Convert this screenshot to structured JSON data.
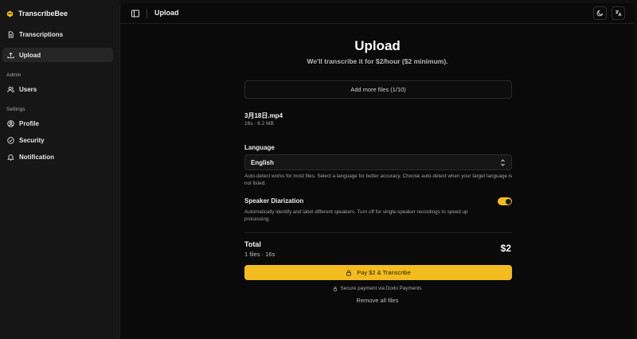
{
  "app": {
    "name": "TranscribeBee",
    "accent_color": "#f2bc1f"
  },
  "sidebar": {
    "items": [
      {
        "label": "Transcriptions",
        "icon": "file-text-icon"
      },
      {
        "label": "Upload",
        "icon": "upload-icon",
        "active": true
      }
    ],
    "admin_label": "Admin",
    "admin_items": [
      {
        "label": "Users",
        "icon": "users-icon"
      }
    ],
    "settings_label": "Settings",
    "settings_items": [
      {
        "label": "Profile",
        "icon": "user-circle-icon"
      },
      {
        "label": "Security",
        "icon": "shield-icon"
      },
      {
        "label": "Notification",
        "icon": "bell-icon"
      }
    ]
  },
  "topbar": {
    "title": "Upload",
    "buttons": [
      "moon-icon",
      "language-icon"
    ]
  },
  "upload": {
    "title": "Upload",
    "subtitle": "We'll transcribe it for $2/hour ($2 minimum).",
    "add_files_label": "Add more files (1/10)",
    "file": {
      "name": "3月18日.mp4",
      "meta": "16s · 6.2 MB"
    },
    "language": {
      "label": "Language",
      "selected": "English",
      "help": "Auto-detect works for most files. Select a language for better accuracy. Choose auto-detect when your target language is not listed."
    },
    "diarization": {
      "label": "Speaker Diarization",
      "help": "Automatically identify and label different speakers. Turn off for single-speaker recordings to speed up processing.",
      "enabled": true
    },
    "total": {
      "label": "Total",
      "meta": "1 files · 16s",
      "amount": "$2"
    },
    "pay_label": "Pay $2 & Transcribe",
    "secure_label": "Secure payment via Dodo Payments",
    "remove_all_label": "Remove all files"
  }
}
